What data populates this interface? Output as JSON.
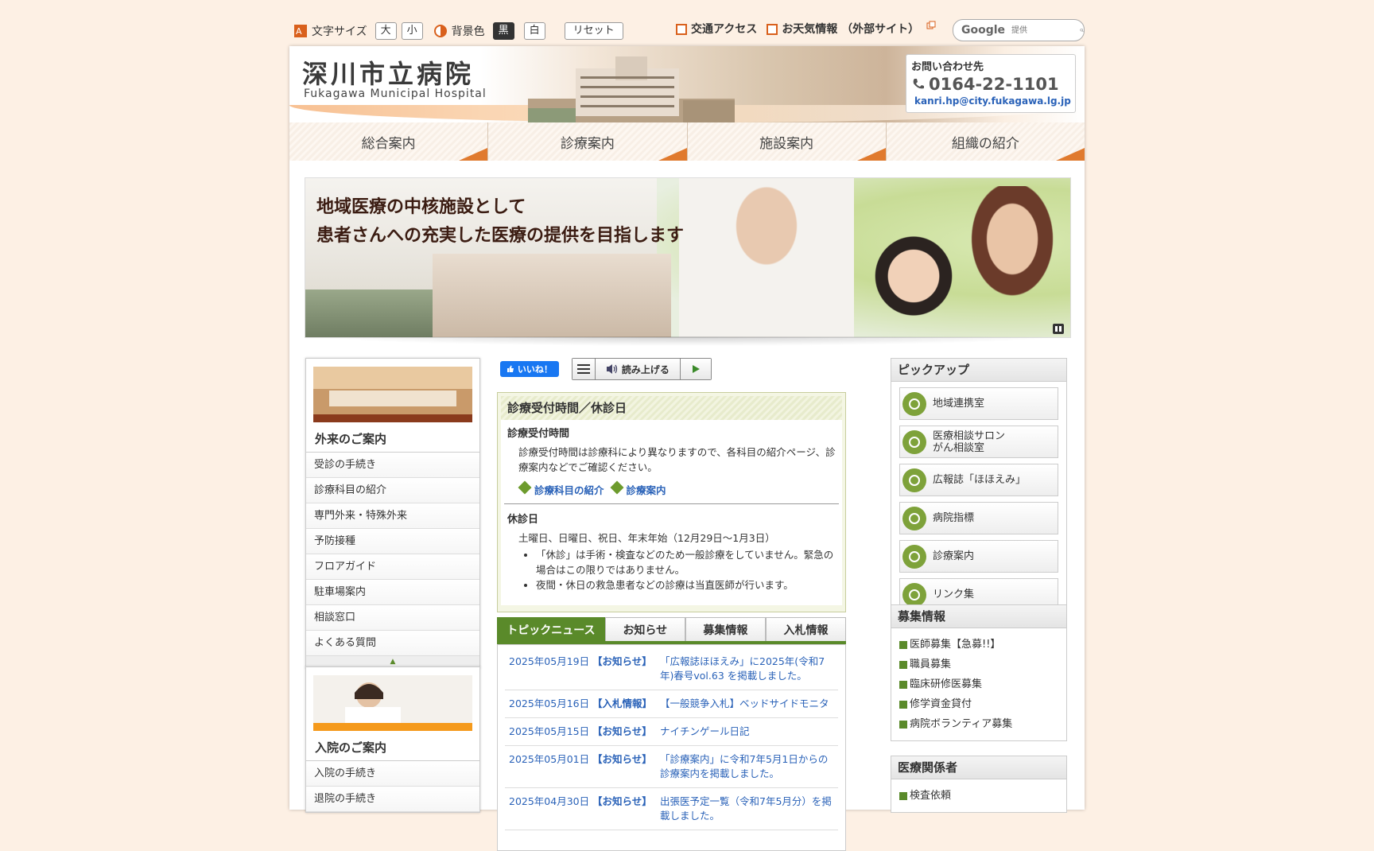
{
  "utility": {
    "font_size_label": "文字サイズ",
    "font_large": "大",
    "font_small": "小",
    "bg_label": "背景色",
    "bg_black": "黒",
    "bg_white": "白",
    "reset": "リセット"
  },
  "toplinks": [
    "交通アクセス",
    "お天気情報 （外部サイト）"
  ],
  "search": {
    "placeholder": "提供",
    "brand": "Google"
  },
  "header": {
    "logo_jp": "深川市立病院",
    "logo_en": "Fukagawa Municipal Hospital",
    "contact_title": "お問い合わせ先",
    "phone": "0164-22-1101",
    "email": "kanri.hp@city.fukagawa.lg.jp"
  },
  "nav": [
    "総合案内",
    "診療案内",
    "施設案内",
    "組織の紹介"
  ],
  "hero": {
    "line1": "地域医療の中核施設として",
    "line2": "患者さんへの充実した医療の提供を目指します"
  },
  "outpatient": {
    "title": "外来のご案内",
    "items": [
      "受診の手続き",
      "診療科目の紹介",
      "専門外来・特殊外来",
      "予防接種",
      "フロアガイド",
      "駐車場案内",
      "相談窓口",
      "よくある質問"
    ],
    "toggle": "▲"
  },
  "inpatient": {
    "title": "入院のご案内",
    "items": [
      "入院の手続き",
      "退院の手続き"
    ]
  },
  "social": {
    "like": "いいね！",
    "read": "読み上げる"
  },
  "hours": {
    "title": "診療受付時間／休診日",
    "sec1_title": "診療受付時間",
    "sec1_text": "診療受付時間は診療科により異なりますので、各科目の紹介ページ、診療案内などでご確認ください。",
    "link1": "診療科目の紹介",
    "link2": "診療案内",
    "sec2_title": "休診日",
    "sec2_text": "土曜日、日曜日、祝日、年末年始（12月29日～1月3日）",
    "bullets": [
      "「休診」は手術・検査などのため一般診療をしていません。緊急の場合はこの限りではありません。",
      "夜間・休日の救急患者などの診療は当直医師が行います。"
    ]
  },
  "tabs": [
    "トピックニュース",
    "お知らせ",
    "募集情報",
    "入札情報"
  ],
  "news": [
    {
      "date": "2025年05月19日",
      "cat": "【お知らせ】",
      "text": "「広報誌ほほえみ」に2025年(令和7年)春号vol.63 を掲載しました。"
    },
    {
      "date": "2025年05月16日",
      "cat": "【入札情報】",
      "text": "【一般競争入札】ベッドサイドモニタ"
    },
    {
      "date": "2025年05月15日",
      "cat": "【お知らせ】",
      "text": "ナイチンゲール日記"
    },
    {
      "date": "2025年05月01日",
      "cat": "【お知らせ】",
      "text": "「診療案内」に令和7年5月1日からの診療案内を掲載しました。"
    },
    {
      "date": "2025年04月30日",
      "cat": "【お知らせ】",
      "text": "出張医予定一覧（令和7年5月分）を掲載しました。"
    }
  ],
  "pickup": {
    "title": "ピックアップ",
    "items": [
      "地域連携室",
      "医療相談サロン\nがん相談室",
      "広報誌「ほほえみ」",
      "病院指標",
      "診療案内",
      "リンク集"
    ]
  },
  "recruit": {
    "title": "募集情報",
    "items": [
      "医師募集【急募!!】",
      "職員募集",
      "臨床研修医募集",
      "修学資金貸付",
      "病院ボランティア募集"
    ]
  },
  "medical": {
    "title": "医療関係者",
    "items": [
      "検査依頼"
    ]
  }
}
